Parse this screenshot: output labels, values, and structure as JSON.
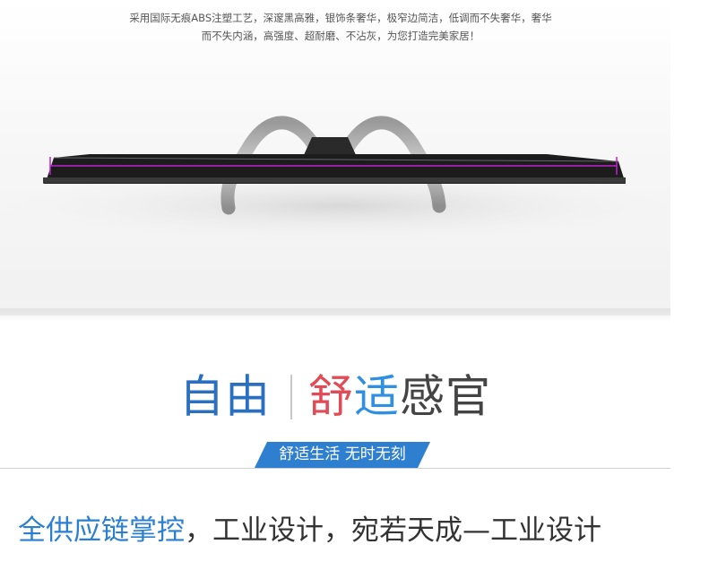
{
  "description": {
    "line1": "采用国际无痕ABS注塑工艺，深邃黑高雅，银饰条奢华，极窄边简洁，低调而不失奢华，奢华",
    "line2": "而不失内涵，高强度、超耐磨、不沾灰，为您打造完美家居！"
  },
  "headline": {
    "part1": "自由",
    "part2": "舒",
    "part3": "适",
    "part4": "感官"
  },
  "ribbon": {
    "label": "舒适生活 无时无刻"
  },
  "tagline": {
    "highlight": "全供应链掌控",
    "rest": "，工业设计，宛若天成—工业设计"
  },
  "colors": {
    "blue": "#2a6fc0",
    "red": "#e04b55",
    "light_blue": "#2f8fe0",
    "ribbon": "#2f7fd0",
    "measure_line": "#c020d0"
  },
  "image": {
    "subject": "tv-top-view-with-stand"
  }
}
